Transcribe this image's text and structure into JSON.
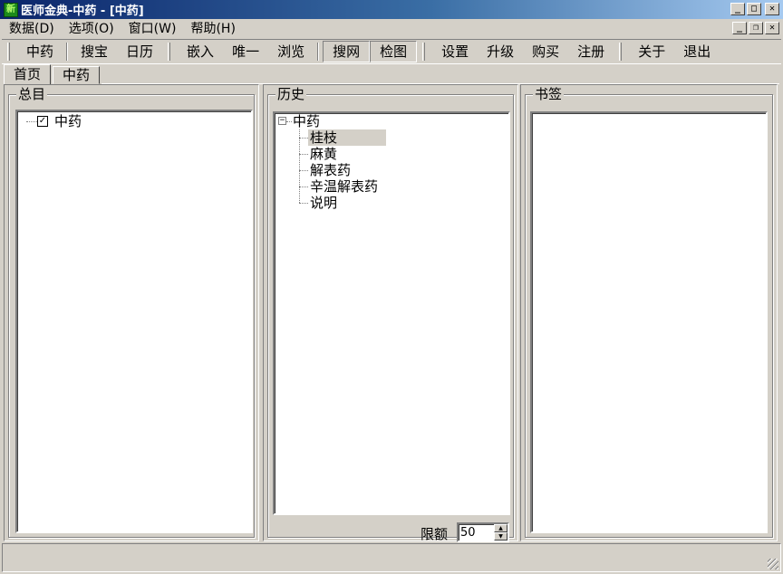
{
  "window": {
    "app_icon_text": "新",
    "title": "医师金典-中药 - [中药]",
    "caption_minimize": "_",
    "caption_maximize": "□",
    "caption_close": "✕",
    "mdi_minimize": "_",
    "mdi_restore": "❐",
    "mdi_close": "✕"
  },
  "menu": [
    "数据(D)",
    "选项(O)",
    "窗口(W)",
    "帮助(H)"
  ],
  "toolbar": {
    "group1": [
      "中药",
      "搜宝",
      "日历"
    ],
    "group2": [
      "嵌入",
      "唯一",
      "浏览"
    ],
    "group3": [
      "搜网",
      "检图"
    ],
    "group4": [
      "设置",
      "升级",
      "购买",
      "注册"
    ],
    "group5": [
      "关于",
      "退出"
    ]
  },
  "tabs": [
    {
      "label": "首页",
      "active": true
    },
    {
      "label": "中药",
      "active": false
    }
  ],
  "catalog": {
    "title": "总目",
    "items": [
      {
        "label": "中药",
        "checked": true,
        "check_mark": "✓"
      }
    ]
  },
  "history": {
    "title": "历史",
    "root": "中药",
    "expander": "−",
    "items": [
      "桂枝",
      "麻黄",
      "解表药",
      "辛温解表药",
      "说明"
    ],
    "selected_index": 0,
    "limit_label": "限额",
    "limit_value": "50",
    "spin_up": "▲",
    "spin_down": "▼"
  },
  "bookmarks": {
    "title": "书签"
  }
}
